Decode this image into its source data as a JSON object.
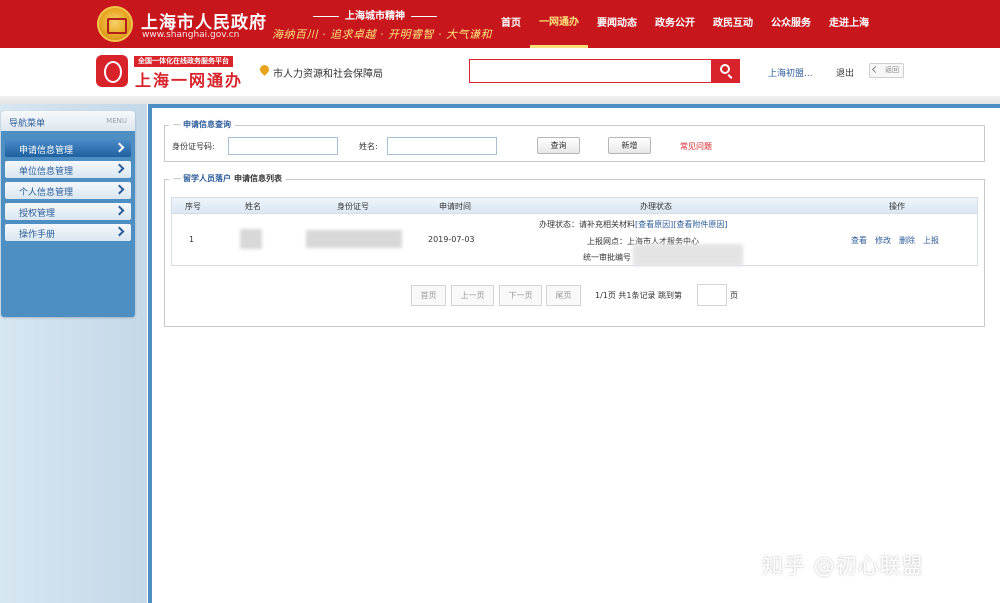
{
  "top_bar": {
    "gov_name": "上海市人民政府",
    "gov_url": "www.shanghai.gov.cn",
    "spirit_title": "上海城市精神",
    "spirit_text": "海纳百川 · 追求卓越 · 开明睿智 · 大气谦和",
    "nav": [
      "首页",
      "一网通办",
      "要闻动态",
      "政务公开",
      "政民互动",
      "公众服务",
      "走进上海"
    ],
    "active_nav": "一网通办"
  },
  "sub_header": {
    "platform_slogan": "全国一体化在线政务服务平台",
    "platform_name": "上海一网通办",
    "department": "市人力资源和社会保障局",
    "search_placeholder": "",
    "user_name": "上海初盟...",
    "logout": "退出",
    "back": "返回"
  },
  "sidebar": {
    "title": "导航菜单",
    "title_en": "MENU",
    "items": [
      {
        "label": "申请信息管理",
        "active": true
      },
      {
        "label": "单位信息管理",
        "active": false
      },
      {
        "label": "个人信息管理",
        "active": false
      },
      {
        "label": "授权管理",
        "active": false
      },
      {
        "label": "操作手册",
        "active": false
      }
    ]
  },
  "query": {
    "legend": "申请信息查询",
    "id_label": "身份证号码:",
    "name_label": "姓名:",
    "id_value": "",
    "name_value": "",
    "search_btn": "查询",
    "add_btn": "新增",
    "faq": "常见问题"
  },
  "list": {
    "legend_prefix": "留学人员落户",
    "legend_main": "申请信息列表",
    "columns": [
      "序号",
      "姓名",
      "身份证号",
      "申请时间",
      "办理状态",
      "操作"
    ],
    "rows": [
      {
        "index": "1",
        "apply_date": "2019-07-03",
        "status_line1_label": "办理状态：请补充相关材料",
        "status_link1": "[查看原因]",
        "status_link2": "[查看附件原因]",
        "status_line2": "上报网点：上海市人才服务中心",
        "status_line3": "统一审批编号",
        "actions": [
          "查看",
          "修改",
          "删除",
          "上报"
        ]
      }
    ]
  },
  "pager": {
    "first": "首页",
    "prev": "上一页",
    "next": "下一页",
    "last": "尾页",
    "summary": "1/1页 共1条记录 跳到第",
    "unit": "页"
  },
  "watermark": "知乎 @初心联盟"
}
